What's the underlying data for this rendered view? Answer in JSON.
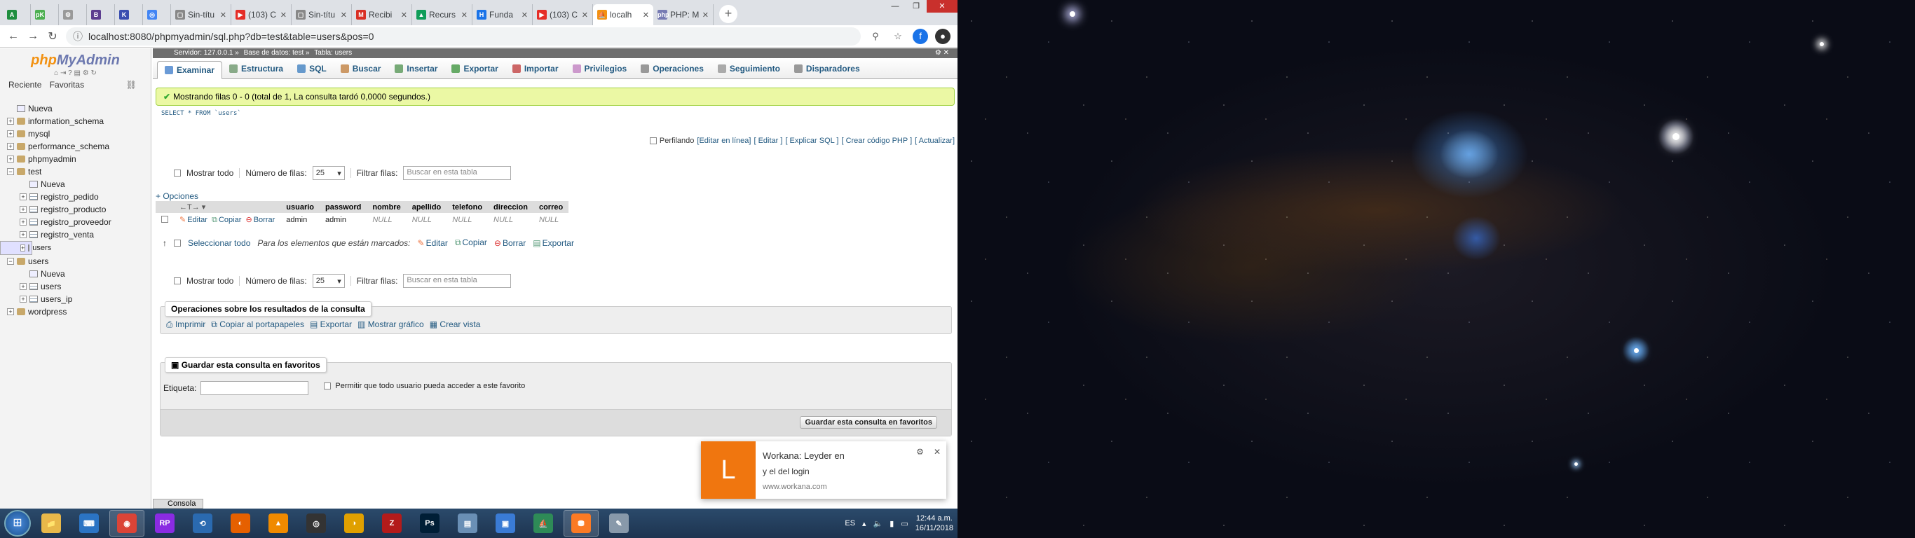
{
  "browser": {
    "tabs": [
      {
        "label": "",
        "favicon": "#1e8e3e",
        "glyph": "A",
        "w": "sm"
      },
      {
        "label": "",
        "favicon": "#4caf50",
        "glyph": "pK",
        "w": "sm"
      },
      {
        "label": "",
        "favicon": "#999",
        "glyph": "⚙",
        "w": "sm"
      },
      {
        "label": "",
        "favicon": "#5c3d8f",
        "glyph": "B",
        "w": "sm"
      },
      {
        "label": "",
        "favicon": "#3a4eb0",
        "glyph": "K",
        "w": "sm"
      },
      {
        "label": "",
        "favicon": "#4285f4",
        "glyph": "◎",
        "w": "sm"
      },
      {
        "label": "Sin-títu",
        "favicon": "#888",
        "glyph": "▢",
        "w": "md"
      },
      {
        "label": "(103) C",
        "favicon": "#e52d27",
        "glyph": "▶",
        "w": "md"
      },
      {
        "label": "Sin-títu",
        "favicon": "#888",
        "glyph": "▢",
        "w": "md"
      },
      {
        "label": "Recibi",
        "favicon": "#d93025",
        "glyph": "M",
        "w": "md"
      },
      {
        "label": "Recurs",
        "favicon": "#0f9d58",
        "glyph": "▲",
        "w": "md"
      },
      {
        "label": "Funda",
        "favicon": "#1a73e8",
        "glyph": "H",
        "w": "md"
      },
      {
        "label": "(103) C",
        "favicon": "#e52d27",
        "glyph": "▶",
        "w": "md"
      },
      {
        "label": "localh",
        "favicon": "#f29111",
        "glyph": "⛵",
        "w": "md",
        "active": true
      },
      {
        "label": "PHP: M",
        "favicon": "#777bb3",
        "glyph": "php",
        "w": "md"
      }
    ],
    "url_text": "localhost:8080/phpmyadmin/sql.php?db=test&table=users&pos=0"
  },
  "pma": {
    "logo_a": "php",
    "logo_b": "MyAdmin",
    "side_links": [
      "Reciente",
      "Favoritas"
    ],
    "tree": [
      {
        "label": "Nueva",
        "level": 0,
        "kind": "new"
      },
      {
        "label": "information_schema",
        "level": 0,
        "kind": "db"
      },
      {
        "label": "mysql",
        "level": 0,
        "kind": "db"
      },
      {
        "label": "performance_schema",
        "level": 0,
        "kind": "db"
      },
      {
        "label": "phpmyadmin",
        "level": 0,
        "kind": "db"
      },
      {
        "label": "test",
        "level": 0,
        "kind": "db",
        "open": true
      },
      {
        "label": "Nueva",
        "level": 1,
        "kind": "new"
      },
      {
        "label": "registro_pedido",
        "level": 1,
        "kind": "tb"
      },
      {
        "label": "registro_producto",
        "level": 1,
        "kind": "tb"
      },
      {
        "label": "registro_proveedor",
        "level": 1,
        "kind": "tb"
      },
      {
        "label": "registro_venta",
        "level": 1,
        "kind": "tb"
      },
      {
        "label": "users",
        "level": 1,
        "kind": "tb",
        "sel": true
      },
      {
        "label": "users",
        "level": 0,
        "kind": "db",
        "open": true
      },
      {
        "label": "Nueva",
        "level": 1,
        "kind": "new"
      },
      {
        "label": "users",
        "level": 1,
        "kind": "tb"
      },
      {
        "label": "users_ip",
        "level": 1,
        "kind": "tb"
      },
      {
        "label": "wordpress",
        "level": 0,
        "kind": "db"
      }
    ],
    "crumb": [
      "Servidor: 127.0.0.1 »",
      "Base de datos: test »",
      "Tabla: users"
    ],
    "tabs": [
      {
        "label": "Examinar",
        "color": "#6a9ad6",
        "active": true
      },
      {
        "label": "Estructura",
        "color": "#8a8"
      },
      {
        "label": "SQL",
        "color": "#69c"
      },
      {
        "label": "Buscar",
        "color": "#c96"
      },
      {
        "label": "Insertar",
        "color": "#7a7"
      },
      {
        "label": "Exportar",
        "color": "#6a6"
      },
      {
        "label": "Importar",
        "color": "#c66"
      },
      {
        "label": "Privilegios",
        "color": "#c9c"
      },
      {
        "label": "Operaciones",
        "color": "#999"
      },
      {
        "label": "Seguimiento",
        "color": "#aaa"
      },
      {
        "label": "Disparadores",
        "color": "#999"
      }
    ],
    "success": "Mostrando filas 0 - 0 (total de 1, La consulta tardó 0,0000 segundos.)",
    "query": "SELECT * FROM `users`",
    "profiling": "Perfilando",
    "profiling_links": [
      "[Editar en línea]",
      "[ Editar ]",
      "[ Explicar SQL ]",
      "[ Crear código PHP ]",
      "[ Actualizar]"
    ],
    "nav": {
      "show_all": "Mostrar todo",
      "rows_label": "Número de filas:",
      "rows_value": "25",
      "filter_label": "Filtrar filas:",
      "filter_placeholder": "Buscar en esta tabla"
    },
    "options": "+ Opciones",
    "columns": [
      "usuario",
      "password",
      "nombre",
      "apellido",
      "telefono",
      "direccion",
      "correo"
    ],
    "row": {
      "edit": "Editar",
      "copy": "Copiar",
      "delete": "Borrar",
      "usuario": "admin",
      "password": "admin",
      "nombre": "NULL",
      "apellido": "NULL",
      "telefono": "NULL",
      "direccion": "NULL",
      "correo": "NULL"
    },
    "mark": {
      "select_all": "Seleccionar todo",
      "with_selected": "Para los elementos que están marcados:",
      "edit": "Editar",
      "copy": "Copiar",
      "delete": "Borrar",
      "export": "Exportar"
    },
    "ops_legend": "Operaciones sobre los resultados de la consulta",
    "ops": [
      "Imprimir",
      "Copiar al portapapeles",
      "Exportar",
      "Mostrar gráfico",
      "Crear vista"
    ],
    "fav_legend": "Guardar esta consulta en favoritos",
    "fav_label_text": "Etiqueta:",
    "fav_share": "Permitir que todo usuario pueda acceder a este favorito",
    "fav_button": "Guardar esta consulta en favoritos",
    "console": "Consola"
  },
  "notification": {
    "letter": "L",
    "title": "Workana: Leyder  en",
    "body": "y el del login",
    "source": "www.workana.com"
  },
  "taskbar": {
    "apps": [
      {
        "name": "explorer",
        "color": "#e8b84a",
        "glyph": "📁"
      },
      {
        "name": "vscode",
        "color": "#2b74c4",
        "glyph": "⌨"
      },
      {
        "name": "chrome",
        "color": "#db4437",
        "glyph": "◉",
        "on": true
      },
      {
        "name": "rp",
        "color": "#8a2be2",
        "glyph": "RP"
      },
      {
        "name": "app5",
        "color": "#2a6ab0",
        "glyph": "⟲"
      },
      {
        "name": "firefox",
        "color": "#e66000",
        "glyph": "◐"
      },
      {
        "name": "vlc",
        "color": "#f08a00",
        "glyph": "▲"
      },
      {
        "name": "app8",
        "color": "#333",
        "glyph": "◎"
      },
      {
        "name": "app9",
        "color": "#e0a000",
        "glyph": "◑"
      },
      {
        "name": "filezilla",
        "color": "#b31b1b",
        "glyph": "Z"
      },
      {
        "name": "photoshop",
        "color": "#001e36",
        "glyph": "Ps"
      },
      {
        "name": "app12",
        "color": "#6a8fb5",
        "glyph": "▤"
      },
      {
        "name": "app13",
        "color": "#3a7bd5",
        "glyph": "▣"
      },
      {
        "name": "app14",
        "color": "#2e8b57",
        "glyph": "⛵"
      },
      {
        "name": "xampp",
        "color": "#fb7a24",
        "glyph": "⛃",
        "on": true
      },
      {
        "name": "paint",
        "color": "#89a",
        "glyph": "✎"
      }
    ],
    "lang": "ES",
    "time": "12:44 a.m.",
    "date": "16/11/2018"
  }
}
